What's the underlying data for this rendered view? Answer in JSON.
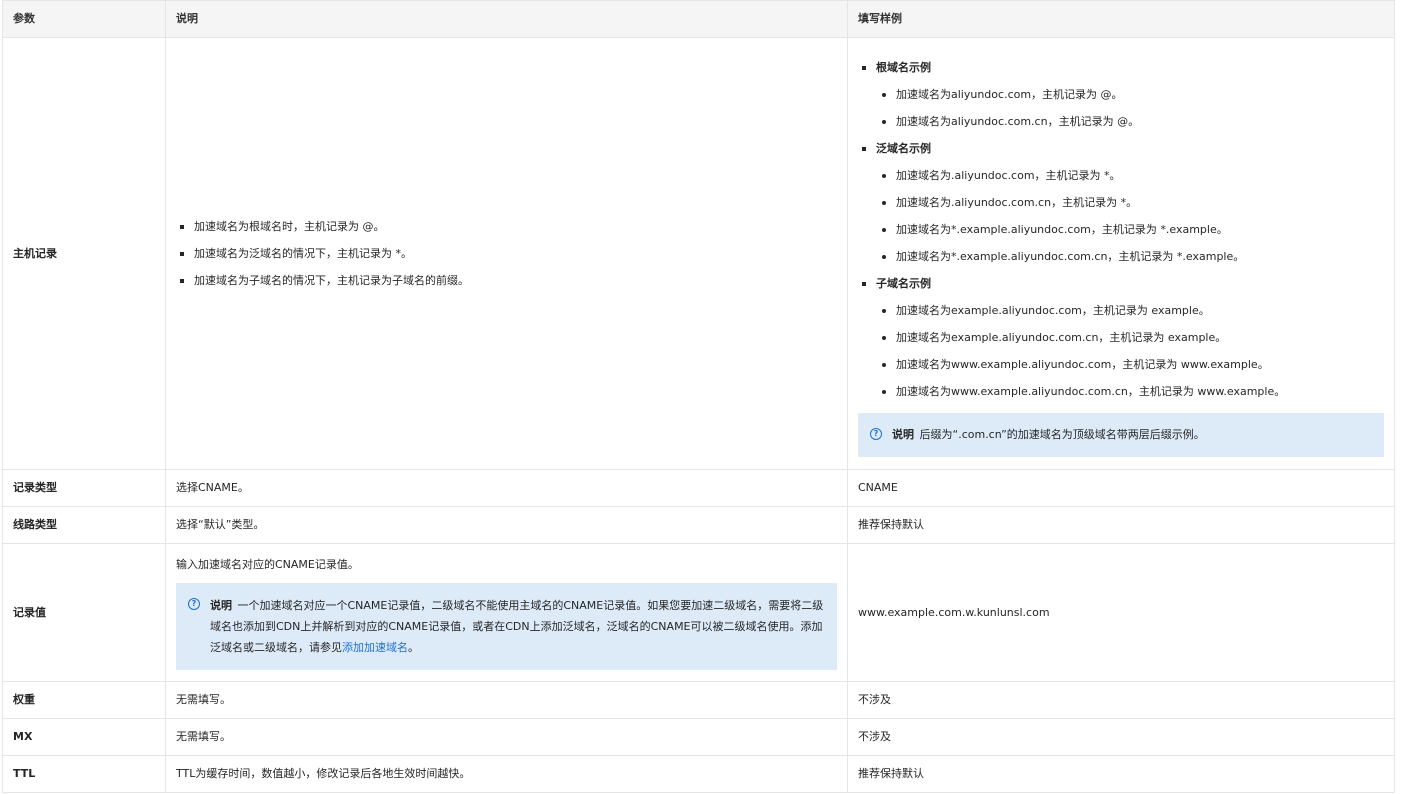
{
  "header": {
    "col1": "参数",
    "col2": "说明",
    "col3": "填写样例"
  },
  "rows": {
    "host": {
      "param": "主机记录",
      "desc": [
        "加速域名为根域名时，主机记录为 @。",
        "加速域名为泛域名的情况下，主机记录为 *。",
        "加速域名为子域名的情况下，主机记录为子域名的前缀。"
      ],
      "groups": [
        {
          "title": "根域名示例",
          "items": [
            {
              "text": "加速域名为aliyundoc.com，主机记录为 @。"
            },
            {
              "text": "加速域名为aliyundoc.com.cn，主机记录为 @。"
            }
          ]
        },
        {
          "title": "泛域名示例",
          "items": [
            {
              "text": "加速域名为.aliyundoc.com，主机记录为 *。"
            },
            {
              "text": "加速域名为.aliyundoc.com.cn，主机记录为 *。"
            },
            {
              "text": "加速域名为*.example.aliyundoc.com，主机记录为 *.example。"
            },
            {
              "text": "加速域名为*.example.aliyundoc.com.cn，主机记录为 *.example。"
            }
          ]
        },
        {
          "title": "子域名示例",
          "items": [
            {
              "text": "加速域名为example.aliyundoc.com，主机记录为 example。"
            },
            {
              "text": "加速域名为example.aliyundoc.com.cn，主机记录为 example。"
            },
            {
              "text": "加速域名为www.example.aliyundoc.com，主机记录为 www.example。"
            },
            {
              "text": "加速域名为www.example.aliyundoc.com.cn，主机记录为 www.example。"
            }
          ]
        }
      ],
      "note": {
        "label": "说明",
        "text": "后缀为“.com.cn”的加速域名为顶级域名带两层后缀示例。"
      }
    },
    "type": {
      "param": "记录类型",
      "desc": "选择CNAME。",
      "example": "CNAME"
    },
    "line": {
      "param": "线路类型",
      "desc": "选择“默认”类型。",
      "example": "推荐保持默认"
    },
    "value": {
      "param": "记录值",
      "desc": "输入加速域名对应的CNAME记录值。",
      "note": {
        "label": "说明",
        "text": "一个加速域名对应一个CNAME记录值，二级域名不能使用主域名的CNAME记录值。如果您要加速二级域名，需要将二级域名也添加到CDN上并解析到对应的CNAME记录值，或者在CDN上添加泛域名，泛域名的CNAME可以被二级域名使用。添加泛域名或二级域名，请参见",
        "link": "添加加速域名",
        "tail": "。"
      },
      "example": "www.example.com.w.kunlunsl.com"
    },
    "weight": {
      "param": "权重",
      "desc": "无需填写。",
      "example": "不涉及"
    },
    "mx": {
      "param": "MX",
      "desc": "无需填写。",
      "example": "不涉及"
    },
    "ttl": {
      "param": "TTL",
      "desc": "TTL为缓存时间，数值越小，修改记录后各地生效时间越快。",
      "example": "推荐保持默认"
    }
  }
}
